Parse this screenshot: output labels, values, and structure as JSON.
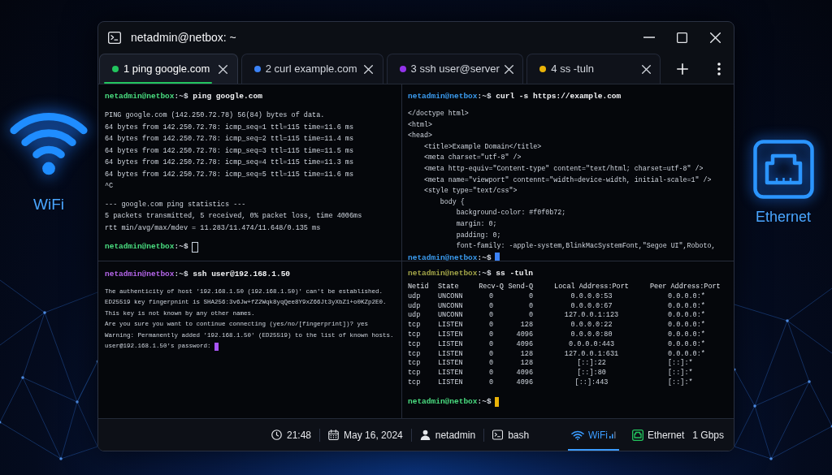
{
  "window": {
    "title": "netadmin@netbox: ~"
  },
  "tabs": [
    {
      "label": "1 ping google.com",
      "color": "#22c55e",
      "selected": true
    },
    {
      "label": "2 curl example.com",
      "color": "#3b82f6",
      "selected": false
    },
    {
      "label": "3 ssh user@server",
      "color": "#9333ea",
      "selected": false
    },
    {
      "label": "4 ss -tuln",
      "color": "#eab308",
      "selected": false
    }
  ],
  "panes": [
    {
      "lines": [
        {
          "kind": "prompt",
          "user": "netadmin@netbox",
          "suffix": ":~$",
          "command": "ping google.com",
          "color": "#4ade80"
        },
        {
          "kind": "gap"
        },
        {
          "kind": "output",
          "text": "PING google.com (142.250.72.78) 56(84) bytes of data."
        },
        {
          "kind": "output",
          "text": "64 bytes from 142.250.72.78: icmp_seq=1 ttl=115 time=11.6 ms"
        },
        {
          "kind": "output",
          "text": "64 bytes from 142.250.72.78: icmp_seq=2 ttl=115 time=11.4 ms"
        },
        {
          "kind": "output",
          "text": "64 bytes from 142.250.72.78: icmp_seq=3 ttl=115 time=11.5 ms"
        },
        {
          "kind": "output",
          "text": "64 bytes from 142.250.72.78: icmp_seq=4 ttl=115 time=11.3 ms"
        },
        {
          "kind": "output",
          "text": "64 bytes from 142.250.72.78: icmp_seq=5 ttl=115 time=11.6 ms"
        },
        {
          "kind": "output",
          "text": "^C"
        },
        {
          "kind": "gap"
        },
        {
          "kind": "output",
          "text": "--- google.com ping statistics ---"
        },
        {
          "kind": "output",
          "text": "5 packets transmitted, 5 received, 0% packet loss, time 4006ms"
        },
        {
          "kind": "output",
          "text": "rtt min/avg/max/mdev = 11.283/11.474/11.648/0.135 ms"
        },
        {
          "kind": "gap"
        },
        {
          "kind": "prompt",
          "user": "netadmin@netbox",
          "suffix": ":~$",
          "color": "#4ade80",
          "cursor": {
            "kind": "hollow",
            "color": "#cbd5e1"
          }
        }
      ]
    },
    {
      "lines": [
        {
          "kind": "prompt",
          "user": "netadmin@netbox",
          "suffix": ":~$",
          "command": "curl -s https://example.com",
          "color": "#3b9cf0"
        },
        {
          "kind": "gap"
        },
        {
          "kind": "output",
          "text": "</doctype html>"
        },
        {
          "kind": "output",
          "text": "<html>"
        },
        {
          "kind": "output",
          "text": "<head>"
        },
        {
          "kind": "output",
          "text": "    <title>Example Domain</title>"
        },
        {
          "kind": "output",
          "text": "    <meta charset=\"utf-8\" />"
        },
        {
          "kind": "output",
          "text": "    <meta http-equiv=\"Content-type\" content=\"text/html; charset=utf-8\" />"
        },
        {
          "kind": "output",
          "text": "    <meta name=\"viewport\" contennt=\"width=device-width, initial-scale=1\" />"
        },
        {
          "kind": "output",
          "text": "    <style type=\"text/css\">"
        },
        {
          "kind": "output",
          "text": "        body {"
        },
        {
          "kind": "output",
          "text": "            background-color: #f0f0b72;"
        },
        {
          "kind": "output",
          "text": "            margin: 0;"
        },
        {
          "kind": "output",
          "text": "            padding: 0;"
        },
        {
          "kind": "output",
          "text": "            font-family: -apple-system,BlinkMacSystemFont,\"Segoe UI\",Roboto,"
        },
        {
          "kind": "prompt",
          "user": "netadmin@netbox",
          "suffix": ":~$",
          "color": "#3b9cf0",
          "cursor": {
            "kind": "block",
            "color": "#3b82f6"
          }
        }
      ]
    },
    {
      "lines": [
        {
          "kind": "prompt",
          "user": "netadmin@netbox",
          "suffix": ":~$",
          "command": "ssh user@192.168.1.50",
          "color": "#b566ea"
        },
        {
          "kind": "gap"
        },
        {
          "kind": "output",
          "text": "The authenticity of host '192.168.1.50 (192.168.1.50)' can't be established."
        },
        {
          "kind": "output",
          "text": "ED25519 key fingerpnint is SHA256:3v6Jw+fZ2Wqk8yqQee8Y9xZ66Jt3yXbZ1+o0KZp2E0."
        },
        {
          "kind": "output",
          "text": "This key is not known by any other names."
        },
        {
          "kind": "output",
          "text": "Are you sure you want to continue connecting (yes/no/[fingerprint])? yes"
        },
        {
          "kind": "output",
          "text": "Warning: Permanently added '192.168.1.50' (ED25519) to the list of known hosts."
        },
        {
          "kind": "output",
          "text": "user@192.168.1.50's password:",
          "cursor": {
            "kind": "block",
            "color": "#a855f7"
          }
        }
      ]
    },
    {
      "lines": [
        {
          "kind": "prompt",
          "user": "netadmin@netbox",
          "suffix": ":~$",
          "command": "ss -tuln",
          "color": "#a3a548"
        },
        {
          "kind": "table",
          "columns": [
            "Netid",
            "State",
            "Recv-Q",
            "Send-Q",
            "Local Address:Port",
            "Peer Address:Port"
          ],
          "rows": [
            [
              "udp",
              "UNCONN",
              "0",
              "0",
              "0.0.0.0:53",
              "0.0.0.0:*"
            ],
            [
              "udp",
              "UNCONN",
              "0",
              "0",
              "0.0.0.0:67",
              "0.0.0.0:*"
            ],
            [
              "udp",
              "UNCONN",
              "0",
              "0",
              "127.0.0.1:123",
              "0.0.0.0:*"
            ],
            [
              "tcp",
              "LISTEN",
              "0",
              "128",
              "0.0.0.0:22",
              "0.0.0.0:*"
            ],
            [
              "tcp",
              "LISTEN",
              "0",
              "4096",
              "0.0.0.0:80",
              "0.0.0.0:*"
            ],
            [
              "tcp",
              "LISTEN",
              "0",
              "4096",
              "0.0.0.0:443",
              "0.0.0.0:*"
            ],
            [
              "tcp",
              "LISTEN",
              "0",
              "128",
              "127.0.0.1:631",
              "0.0.0.0:*"
            ],
            [
              "tcp",
              "LISTEN",
              "0",
              "128",
              "[::]:22",
              "[::]:*"
            ],
            [
              "tcp",
              "LISTEN",
              "0",
              "4096",
              "[::]:80",
              "[::]:*"
            ],
            [
              "tcp",
              "LISTEN",
              "0",
              "4096",
              "[::]:443",
              "[::]:*"
            ]
          ]
        },
        {
          "kind": "gap"
        },
        {
          "kind": "prompt",
          "user": "netadmin@netbox",
          "suffix": ":~$",
          "color": "#4ade80",
          "cursor": {
            "kind": "block",
            "color": "#eab308"
          }
        }
      ]
    }
  ],
  "status_bar": {
    "items": [
      {
        "kind": "clock",
        "text": "21:48"
      },
      {
        "kind": "calendar",
        "text": "May 16, 2024"
      },
      {
        "kind": "user",
        "text": "netadmin"
      },
      {
        "kind": "terminal",
        "text": "bash"
      }
    ],
    "connections": [
      {
        "kind": "wifi",
        "label": "WiFi",
        "selected": true
      },
      {
        "kind": "ethernet",
        "label": "Ethernet",
        "detail": "1 Gbps",
        "selected": false
      }
    ]
  },
  "side_panels": [
    {
      "kind": "wifi",
      "label": "WiFi"
    },
    {
      "kind": "ethernet",
      "label": "Ethernet"
    }
  ]
}
